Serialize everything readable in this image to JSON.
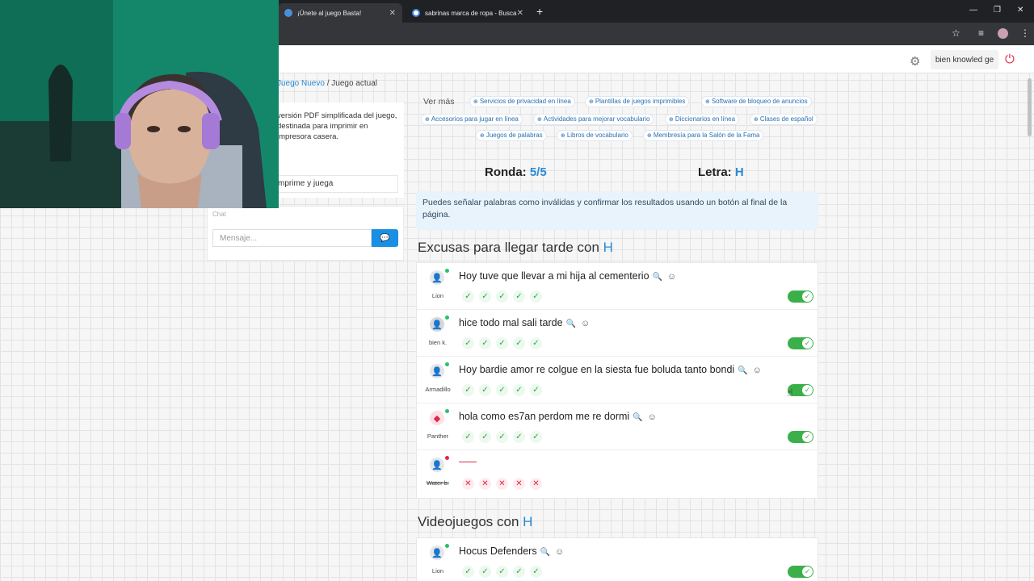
{
  "browser": {
    "tabs": [
      {
        "title": "¡Únete al juego Basta!",
        "active": true
      },
      {
        "title": "sabrinas marca de ropa - Busca",
        "active": false
      }
    ]
  },
  "header": {
    "user": "bien knowled ge"
  },
  "breadcrumb": {
    "link": "Juego Nuevo",
    "separator": "/",
    "current": "Juego actual"
  },
  "sidebar": {
    "pdf_description": "versión PDF simplificada del juego, destinada para imprimir en impresora casera.",
    "print_button": "mprime y juega",
    "chat_label": "Chat",
    "chat_placeholder": "Mensaje..."
  },
  "more": {
    "label": "Ver más",
    "chips": [
      "Servicios de privacidad en línea",
      "Plantillas de juegos imprimibles",
      "Software de bloqueo de anuncios",
      "Accesorios para jugar en línea",
      "Actividades para mejorar vocabulario",
      "Diccionarios en línea",
      "Clases de español",
      "Juegos de palabras",
      "Libros de vocabulario",
      "Membresía para la Salón de la Fama"
    ]
  },
  "game": {
    "round_label": "Ronda:",
    "round_value": "5/5",
    "letter_label": "Letra:",
    "letter_value": "H",
    "info": "Puedes señalar palabras como inválidas y confirmar los resultados usando un botón al final de la página."
  },
  "categories": [
    {
      "title": "Excusas para llegar tarde con",
      "letter": "H",
      "answers": [
        {
          "player": "Lion",
          "text": "Hoy tuve que llevar a mi hija al cementerio",
          "valid": true,
          "online": true
        },
        {
          "player": "bien k.",
          "text": "hice todo mal sali tarde",
          "valid": true,
          "online": true
        },
        {
          "player": "Armadillo",
          "text": "Hoy bardie amor re colgue en la siesta fue boluda tanto bondi",
          "valid": true,
          "online": true
        },
        {
          "player": "Panther",
          "text": "hola como es7an perdom me re dormi",
          "valid": true,
          "online": true
        },
        {
          "player": "Water b.",
          "text": "",
          "valid": false,
          "online": false
        }
      ]
    },
    {
      "title": "Videojuegos con",
      "letter": "H",
      "answers": [
        {
          "player": "Lion",
          "text": "Hocus Defenders",
          "valid": true,
          "online": true
        }
      ]
    }
  ]
}
